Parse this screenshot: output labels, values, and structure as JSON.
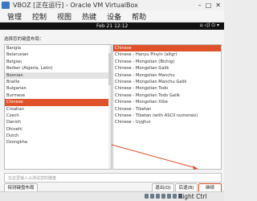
{
  "window": {
    "title": "VBOZ [正在运行] - Oracle VM VirtualBox",
    "minimize": "–",
    "maximize": "□",
    "close": "✕"
  },
  "menu": [
    "管理",
    "控制",
    "视图",
    "热键",
    "设备",
    "帮助"
  ],
  "topbar": {
    "clock": "Feb 21  12:12",
    "tray": "⌂ ◁) ⏻ ▾"
  },
  "dialog": {
    "prompt": "选择您的键盘布局：",
    "left_list": [
      "Bangla",
      "Belarusian",
      "Belgian",
      "Berber (Algeria, Latin)",
      "Bosnian",
      "Braille",
      "Bulgarian",
      "Burmese",
      "Chinese",
      "Croatian",
      "Czech",
      "Danish",
      "Dhivehi",
      "Dutch",
      "Dzongkha"
    ],
    "right_list": [
      "Chinese",
      "Chinese - Hanyu Pinyin (altgr)",
      "Chinese - Mongolian (Bichig)",
      "Chinese - Mongolian Galik",
      "Chinese - Mongolian Manchu",
      "Chinese - Mongolian Manchu Galik",
      "Chinese - Mongolian Todo",
      "Chinese - Mongolian Todo Galik",
      "Chinese - Mongolian Xibe",
      "Chinese - Tibetan",
      "Chinese - Tibetan (with ASCII numerals)",
      "Chinese - Uyghur"
    ],
    "search_placeholder": "在这里输入以测试您的键盘",
    "detect_label": "探测键盘布局",
    "back_label": "退出(Q)",
    "prev_label": "后退(B)",
    "continue_label": "继续"
  },
  "statusbar": {
    "host_key": "Right Ctrl"
  },
  "colors": {
    "accent": "#e0532a",
    "topbar": "#111111"
  }
}
